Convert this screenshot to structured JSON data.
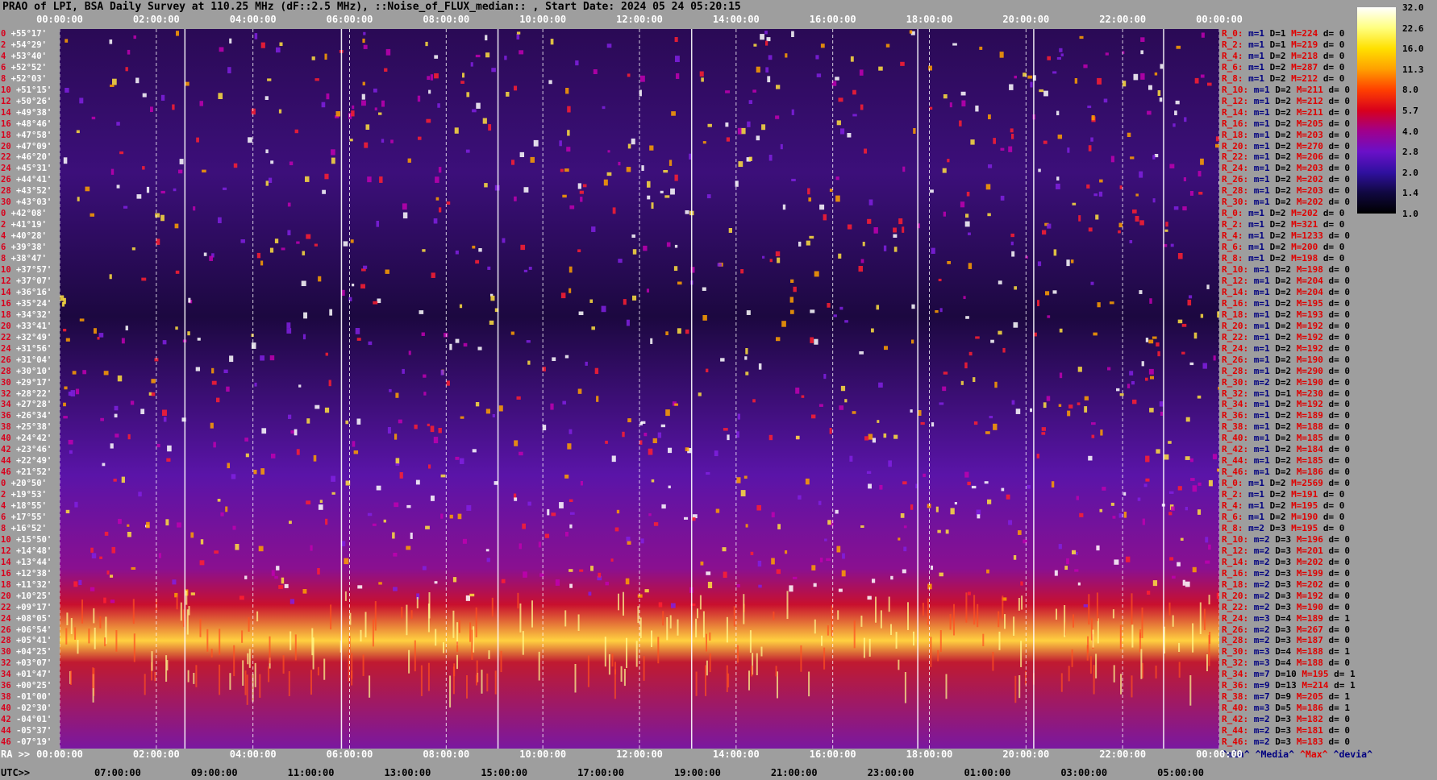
{
  "chart_data": {
    "type": "heatmap",
    "title": "PRAO of LPI, BSA Daily Survey at 110.25 MHz (dF::2.5 MHz), ::Noise_of_FLUX_median:: , Start Date: 2024 05 24 05:20:15",
    "x_ticks_top": [
      "00:00:00",
      "02:00:00",
      "04:00:00",
      "06:00:00",
      "08:00:00",
      "10:00:00",
      "12:00:00",
      "14:00:00",
      "16:00:00",
      "18:00:00",
      "20:00:00",
      "22:00:00",
      "00:00:00"
    ],
    "x_ticks_ra": [
      "00:00:00",
      "02:00:00",
      "04:00:00",
      "06:00:00",
      "08:00:00",
      "10:00:00",
      "12:00:00",
      "14:00:00",
      "16:00:00",
      "18:00:00",
      "20:00:00",
      "22:00:00",
      "00:00:00"
    ],
    "x_ticks_utc": [
      "07:00:00",
      "09:00:00",
      "11:00:00",
      "13:00:00",
      "15:00:00",
      "17:00:00",
      "19:00:00",
      "21:00:00",
      "23:00:00",
      "01:00:00",
      "03:00:00",
      "05:00:00"
    ],
    "ra_label": "RA >>",
    "utc_label": "UTC>>",
    "declinations": [
      "+55°17'",
      "+54°29'",
      "+53°40'",
      "+52°52'",
      "+52°03'",
      "+51°15'",
      "+50°26'",
      "+49°38'",
      "+48°46'",
      "+47°58'",
      "+47°09'",
      "+46°20'",
      "+45°31'",
      "+44°41'",
      "+43°52'",
      "+43°03'",
      "+42°08'",
      "+41°19'",
      "+40°28'",
      "+39°38'",
      "+38°47'",
      "+37°57'",
      "+37°07'",
      "+36°16'",
      "+35°24'",
      "+34°32'",
      "+33°41'",
      "+32°49'",
      "+31°56'",
      "+31°04'",
      "+30°10'",
      "+29°17'",
      "+28°22'",
      "+27°28'",
      "+26°34'",
      "+25°38'",
      "+24°42'",
      "+23°46'",
      "+22°49'",
      "+21°52'",
      "+20°50'",
      "+19°53'",
      "+18°55'",
      "+17°55'",
      "+16°52'",
      "+15°50'",
      "+14°48'",
      "+13°44'",
      "+12°38'",
      "+11°32'",
      "+10°25'",
      "+09°17'",
      "+08°05'",
      "+06°54'",
      "+05°41'",
      "+04°25'",
      "+03°07'",
      "+01°47'",
      "+00°25'",
      "-01°00'",
      "-02°30'",
      "-04°01'",
      "-05°37'",
      "-07°19'"
    ],
    "row_numbers": [
      "0",
      "2",
      "4",
      "6",
      "8",
      "10",
      "12",
      "14",
      "16",
      "18",
      "20",
      "22",
      "24",
      "26",
      "28",
      "30",
      "0",
      "2",
      "4",
      "6",
      "8",
      "10",
      "12",
      "14",
      "16",
      "18",
      "20",
      "22",
      "24",
      "26",
      "28",
      "30",
      "32",
      "34",
      "36",
      "38",
      "40",
      "42",
      "44",
      "46",
      "0",
      "2",
      "4",
      "6",
      "8",
      "10",
      "12",
      "14",
      "16",
      "18",
      "20",
      "22",
      "24",
      "26",
      "28",
      "30",
      "32",
      "34",
      "36",
      "38",
      "40",
      "42",
      "44",
      "46"
    ],
    "stats": [
      [
        "R_0:",
        "1",
        "1",
        "224",
        "0"
      ],
      [
        "R_2:",
        "1",
        "1",
        "219",
        "0"
      ],
      [
        "R_4:",
        "1",
        "2",
        "218",
        "0"
      ],
      [
        "R_6:",
        "1",
        "2",
        "287",
        "0"
      ],
      [
        "R_8:",
        "1",
        "2",
        "212",
        "0"
      ],
      [
        "R_10:",
        "1",
        "2",
        "211",
        "0"
      ],
      [
        "R_12:",
        "1",
        "2",
        "212",
        "0"
      ],
      [
        "R_14:",
        "1",
        "2",
        "211",
        "0"
      ],
      [
        "R_16:",
        "1",
        "2",
        "205",
        "0"
      ],
      [
        "R_18:",
        "1",
        "2",
        "203",
        "0"
      ],
      [
        "R_20:",
        "1",
        "2",
        "270",
        "0"
      ],
      [
        "R_22:",
        "1",
        "2",
        "206",
        "0"
      ],
      [
        "R_24:",
        "1",
        "2",
        "203",
        "0"
      ],
      [
        "R_26:",
        "1",
        "2",
        "202",
        "0"
      ],
      [
        "R_28:",
        "1",
        "2",
        "203",
        "0"
      ],
      [
        "R_30:",
        "1",
        "2",
        "202",
        "0"
      ],
      [
        "R_0:",
        "1",
        "2",
        "202",
        "0"
      ],
      [
        "R_2:",
        "1",
        "2",
        "321",
        "0"
      ],
      [
        "R_4:",
        "1",
        "2",
        "1233",
        "0"
      ],
      [
        "R_6:",
        "1",
        "2",
        "200",
        "0"
      ],
      [
        "R_8:",
        "1",
        "2",
        "198",
        "0"
      ],
      [
        "R_10:",
        "1",
        "2",
        "198",
        "0"
      ],
      [
        "R_12:",
        "1",
        "2",
        "204",
        "0"
      ],
      [
        "R_14:",
        "1",
        "2",
        "204",
        "0"
      ],
      [
        "R_16:",
        "1",
        "2",
        "195",
        "0"
      ],
      [
        "R_18:",
        "1",
        "2",
        "193",
        "0"
      ],
      [
        "R_20:",
        "1",
        "2",
        "192",
        "0"
      ],
      [
        "R_22:",
        "1",
        "2",
        "192",
        "0"
      ],
      [
        "R_24:",
        "1",
        "2",
        "192",
        "0"
      ],
      [
        "R_26:",
        "1",
        "2",
        "190",
        "0"
      ],
      [
        "R_28:",
        "1",
        "2",
        "290",
        "0"
      ],
      [
        "R_30:",
        "2",
        "2",
        "190",
        "0"
      ],
      [
        "R_32:",
        "1",
        "1",
        "230",
        "0"
      ],
      [
        "R_34:",
        "1",
        "2",
        "192",
        "0"
      ],
      [
        "R_36:",
        "1",
        "2",
        "189",
        "0"
      ],
      [
        "R_38:",
        "1",
        "2",
        "188",
        "0"
      ],
      [
        "R_40:",
        "1",
        "2",
        "185",
        "0"
      ],
      [
        "R_42:",
        "1",
        "2",
        "184",
        "0"
      ],
      [
        "R_44:",
        "1",
        "2",
        "185",
        "0"
      ],
      [
        "R_46:",
        "1",
        "2",
        "186",
        "0"
      ],
      [
        "R_0:",
        "1",
        "2",
        "2569",
        "0"
      ],
      [
        "R_2:",
        "1",
        "2",
        "191",
        "0"
      ],
      [
        "R_4:",
        "1",
        "2",
        "195",
        "0"
      ],
      [
        "R_6:",
        "1",
        "2",
        "190",
        "0"
      ],
      [
        "R_8:",
        "2",
        "3",
        "195",
        "0"
      ],
      [
        "R_10:",
        "2",
        "3",
        "196",
        "0"
      ],
      [
        "R_12:",
        "2",
        "3",
        "201",
        "0"
      ],
      [
        "R_14:",
        "2",
        "3",
        "202",
        "0"
      ],
      [
        "R_16:",
        "2",
        "3",
        "199",
        "0"
      ],
      [
        "R_18:",
        "2",
        "3",
        "202",
        "0"
      ],
      [
        "R_20:",
        "2",
        "3",
        "192",
        "0"
      ],
      [
        "R_22:",
        "2",
        "3",
        "190",
        "0"
      ],
      [
        "R_24:",
        "3",
        "4",
        "189",
        "1"
      ],
      [
        "R_26:",
        "2",
        "3",
        "267",
        "0"
      ],
      [
        "R_28:",
        "2",
        "3",
        "187",
        "0"
      ],
      [
        "R_30:",
        "3",
        "4",
        "188",
        "1"
      ],
      [
        "R_32:",
        "3",
        "4",
        "188",
        "0"
      ],
      [
        "R_34:",
        "7",
        "10",
        "195",
        "1"
      ],
      [
        "R_36:",
        "9",
        "13",
        "214",
        "1"
      ],
      [
        "R_38:",
        "7",
        "9",
        "205",
        "1"
      ],
      [
        "R_40:",
        "3",
        "5",
        "186",
        "1"
      ],
      [
        "R_42:",
        "2",
        "3",
        "182",
        "0"
      ],
      [
        "R_44:",
        "2",
        "3",
        "181",
        "0"
      ],
      [
        "R_46:",
        "2",
        "3",
        "183",
        "0"
      ]
    ],
    "stat_prefixes": {
      "m": "m=",
      "D": "D=",
      "M": "M=",
      "d": "d= "
    },
    "legend": {
      "min": "^min^",
      "median": "^Media^",
      "max": "^Max^",
      "devia": "^devia^"
    },
    "colorbar_ticks": [
      "32.0",
      "22.6",
      "16.0",
      "11.3",
      "8.0",
      "5.7",
      "4.0",
      "2.8",
      "2.0",
      "1.4",
      "1.0"
    ],
    "colorbar_colors": [
      "#ffffff",
      "#ffff80",
      "#ffe000",
      "#ffa000",
      "#ff4000",
      "#d8001c",
      "#a0008c",
      "#6a10c8",
      "#3010a0",
      "#100840",
      "#000000"
    ]
  }
}
